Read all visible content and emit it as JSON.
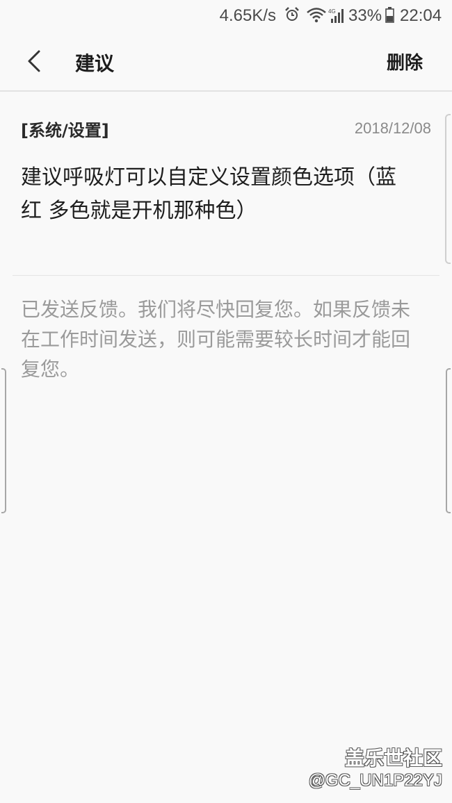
{
  "status_bar": {
    "network_speed": "4.65K/s",
    "alarm_icon": "alarm-clock-icon",
    "wifi_icon": "wifi-icon",
    "signal_label": "4G",
    "battery_percent": "33%",
    "time": "22:04"
  },
  "app_bar": {
    "back_icon": "chevron-left-icon",
    "title": "建议",
    "delete_label": "删除"
  },
  "feedback": {
    "category": "[系统/设置]",
    "date": "2018/12/08",
    "content": "建议呼吸灯可以自定义设置颜色选项（蓝 红 多色就是开机那种色）"
  },
  "notice": "已发送反馈。我们将尽快回复您。如果反馈未在工作时间发送，则可能需要较长时间才能回复您。",
  "watermark": {
    "site": "盖乐世社区",
    "user": "@GC_UN1P22YJ"
  },
  "colors": {
    "background": "#f9f9f9",
    "text": "#1e1e1e",
    "muted": "#9a9a9a"
  }
}
